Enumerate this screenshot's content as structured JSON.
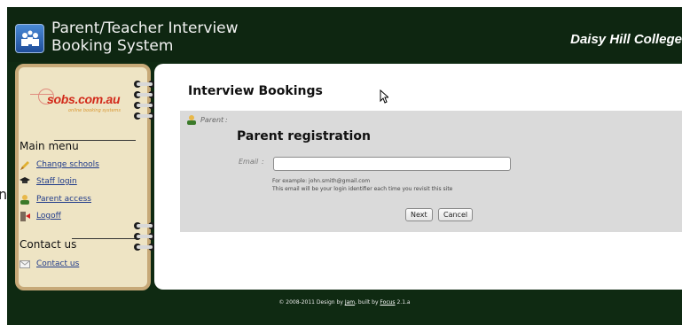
{
  "gutter": {
    "letter": "n"
  },
  "header": {
    "title_line1": "Parent/Teacher Interview",
    "title_line2": "Booking System",
    "school": "Daisy Hill College",
    "logo_icon": "people-icon"
  },
  "sidebar": {
    "brand": "sobs.com.au",
    "brand_tagline": "online booking systems",
    "main_menu_heading": "Main menu",
    "menu_items": [
      {
        "label": "Change schools",
        "icon": "pencil-icon"
      },
      {
        "label": "Staff login",
        "icon": "hat-icon"
      },
      {
        "label": "Parent access",
        "icon": "user-icon"
      },
      {
        "label": "Logoff",
        "icon": "exit-icon"
      }
    ],
    "contact_heading": "Contact us",
    "contact_item": {
      "label": "Contact us",
      "icon": "envelope-icon"
    }
  },
  "main": {
    "page_title": "Interview Bookings",
    "role_label": "Parent",
    "section_title": "Parent registration",
    "email_label": "Email",
    "email_value": "",
    "hint_line1": "For example: john.smith@gmail.com",
    "hint_line2": "This email will be your login identifier each time you revisit this site",
    "next_label": "Next",
    "cancel_label": "Cancel"
  },
  "footer": {
    "prefix": "© 2008-2011 Design by",
    "design_link": "Jam",
    "middle": ", built by",
    "built_link": "Focus",
    "version": "2.1.a"
  },
  "colors": {
    "header_bg": "#0e2611",
    "sidebar_bg": "#eee4c4",
    "sidebar_border": "#c7a978",
    "panel_bg": "#dadada",
    "link": "#1f3a8a"
  }
}
